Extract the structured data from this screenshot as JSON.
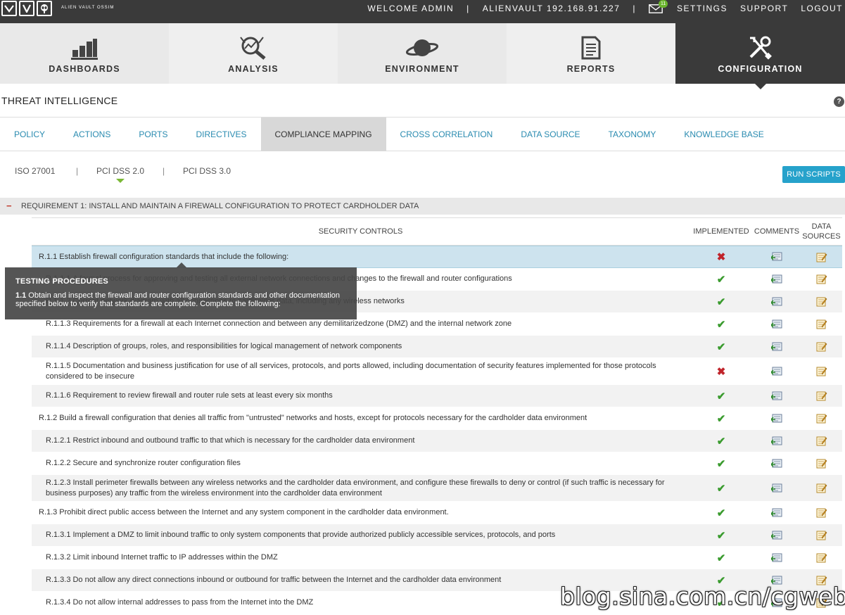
{
  "topbar": {
    "logo_text": "ALIEN VAULT OSSIM",
    "welcome": "WELCOME ADMIN",
    "host": "ALIENVAULT 192.168.91.227",
    "mail_count": "11",
    "settings": "SETTINGS",
    "support": "SUPPORT",
    "logout": "LOGOUT",
    "separator": "|"
  },
  "main_tabs": [
    {
      "label": "DASHBOARDS",
      "icon": "bar-chart-icon"
    },
    {
      "label": "ANALYSIS",
      "icon": "magnifier-chart-icon"
    },
    {
      "label": "ENVIRONMENT",
      "icon": "planet-icon"
    },
    {
      "label": "REPORTS",
      "icon": "document-icon"
    },
    {
      "label": "CONFIGURATION",
      "icon": "tools-icon",
      "active": true
    }
  ],
  "section": {
    "title": "THREAT INTELLIGENCE",
    "help": "?"
  },
  "sub_tabs": [
    {
      "label": "POLICY"
    },
    {
      "label": "ACTIONS"
    },
    {
      "label": "PORTS"
    },
    {
      "label": "DIRECTIVES"
    },
    {
      "label": "COMPLIANCE MAPPING",
      "active": true
    },
    {
      "label": "CROSS CORRELATION"
    },
    {
      "label": "DATA SOURCE"
    },
    {
      "label": "TAXONOMY"
    },
    {
      "label": "KNOWLEDGE BASE"
    }
  ],
  "standards": [
    {
      "label": "ISO 27001"
    },
    {
      "label": "PCI DSS 2.0",
      "active": true
    },
    {
      "label": "PCI DSS 3.0"
    }
  ],
  "standards_separator": "|",
  "run_scripts": "RUN SCRIPTS",
  "requirement": {
    "toggle": "−",
    "title": "REQUIREMENT 1: INSTALL AND MAINTAIN A FIREWALL CONFIGURATION TO PROTECT CARDHOLDER DATA"
  },
  "table": {
    "headers": {
      "controls": "SECURITY CONTROLS",
      "implemented": "IMPLEMENTED",
      "comments": "COMMENTS",
      "data_sources_line1": "DATA",
      "data_sources_line2": "SOURCES"
    },
    "rows": [
      {
        "code": "R.1.1",
        "text": "Establish firewall configuration standards that include the following:",
        "implemented": false,
        "level": 1,
        "selected": true
      },
      {
        "code": "R.1.1.1",
        "text": "A formal process for approving and testing all external network connections and changes to the firewall and router configurations",
        "implemented": true,
        "level": 2
      },
      {
        "code": "R.1.1.2",
        "text": "Current network diagram with all connections to cardholder data, including any wireless networks",
        "implemented": true,
        "level": 2
      },
      {
        "code": "R.1.1.3",
        "text": "Requirements for a firewall at each Internet connection and between any demilitarizedzone (DMZ) and the internal network zone",
        "implemented": true,
        "level": 2
      },
      {
        "code": "R.1.1.4",
        "text": "Description of groups, roles, and responsibilities for logical management of network components",
        "implemented": true,
        "level": 2
      },
      {
        "code": "R.1.1.5",
        "text": "Documentation and business justification for use of all services, protocols, and ports allowed, including documentation of security features implemented for those protocols considered to be insecure",
        "implemented": false,
        "level": 2,
        "tall": true
      },
      {
        "code": "R.1.1.6",
        "text": "Requirement to review firewall and router rule sets at least every six months",
        "implemented": true,
        "level": 2
      },
      {
        "code": "R.1.2",
        "text": "Build a firewall configuration that denies all traffic from \"untrusted\" networks and hosts, except for protocols necessary for the cardholder data environment",
        "implemented": true,
        "level": 1
      },
      {
        "code": "R.1.2.1",
        "text": "Restrict inbound and outbound traffic to that which is necessary for the cardholder data environment",
        "implemented": true,
        "level": 2
      },
      {
        "code": "R.1.2.2",
        "text": "Secure and synchronize router configuration files",
        "implemented": true,
        "level": 2
      },
      {
        "code": "R.1.2.3",
        "text": "Install perimeter firewalls between any wireless networks and the cardholder data environment, and configure these firewalls to deny or control (if such traffic is necessary for business purposes) any traffic from the wireless environment into the cardholder data environment",
        "implemented": true,
        "level": 2,
        "tall": true
      },
      {
        "code": "R.1.3",
        "text": "Prohibit direct public access between the Internet and any system component in the cardholder data environment.",
        "implemented": true,
        "level": 1
      },
      {
        "code": "R.1.3.1",
        "text": "Implement a DMZ to limit inbound traffic to only system components that provide authorized publicly accessible services, protocols, and ports",
        "implemented": true,
        "level": 2
      },
      {
        "code": "R.1.3.2",
        "text": "Limit inbound Internet traffic to IP addresses within the DMZ",
        "implemented": true,
        "level": 2
      },
      {
        "code": "R.1.3.3",
        "text": "Do not allow any direct connections inbound or outbound for traffic between the Internet and the cardholder data environment",
        "implemented": true,
        "level": 2
      },
      {
        "code": "R.1.3.4",
        "text": "Do not allow internal addresses to pass from the Internet into the DMZ",
        "implemented": true,
        "level": 2
      }
    ]
  },
  "tooltip": {
    "title": "TESTING PROCEDURES",
    "number": "1.1",
    "body": "Obtain and inspect the firewall and router configuration standards and other documentation specified below to verify that standards are complete. Complete the following:"
  },
  "watermark": "blog.sina.com.cn/cgweb",
  "colors": {
    "topbar": "#3a3a3a",
    "link": "#2a8bb0",
    "button": "#26a2cb",
    "check": "#3a9b2e",
    "cross": "#c0242b",
    "selected_row": "#cde3ee"
  }
}
